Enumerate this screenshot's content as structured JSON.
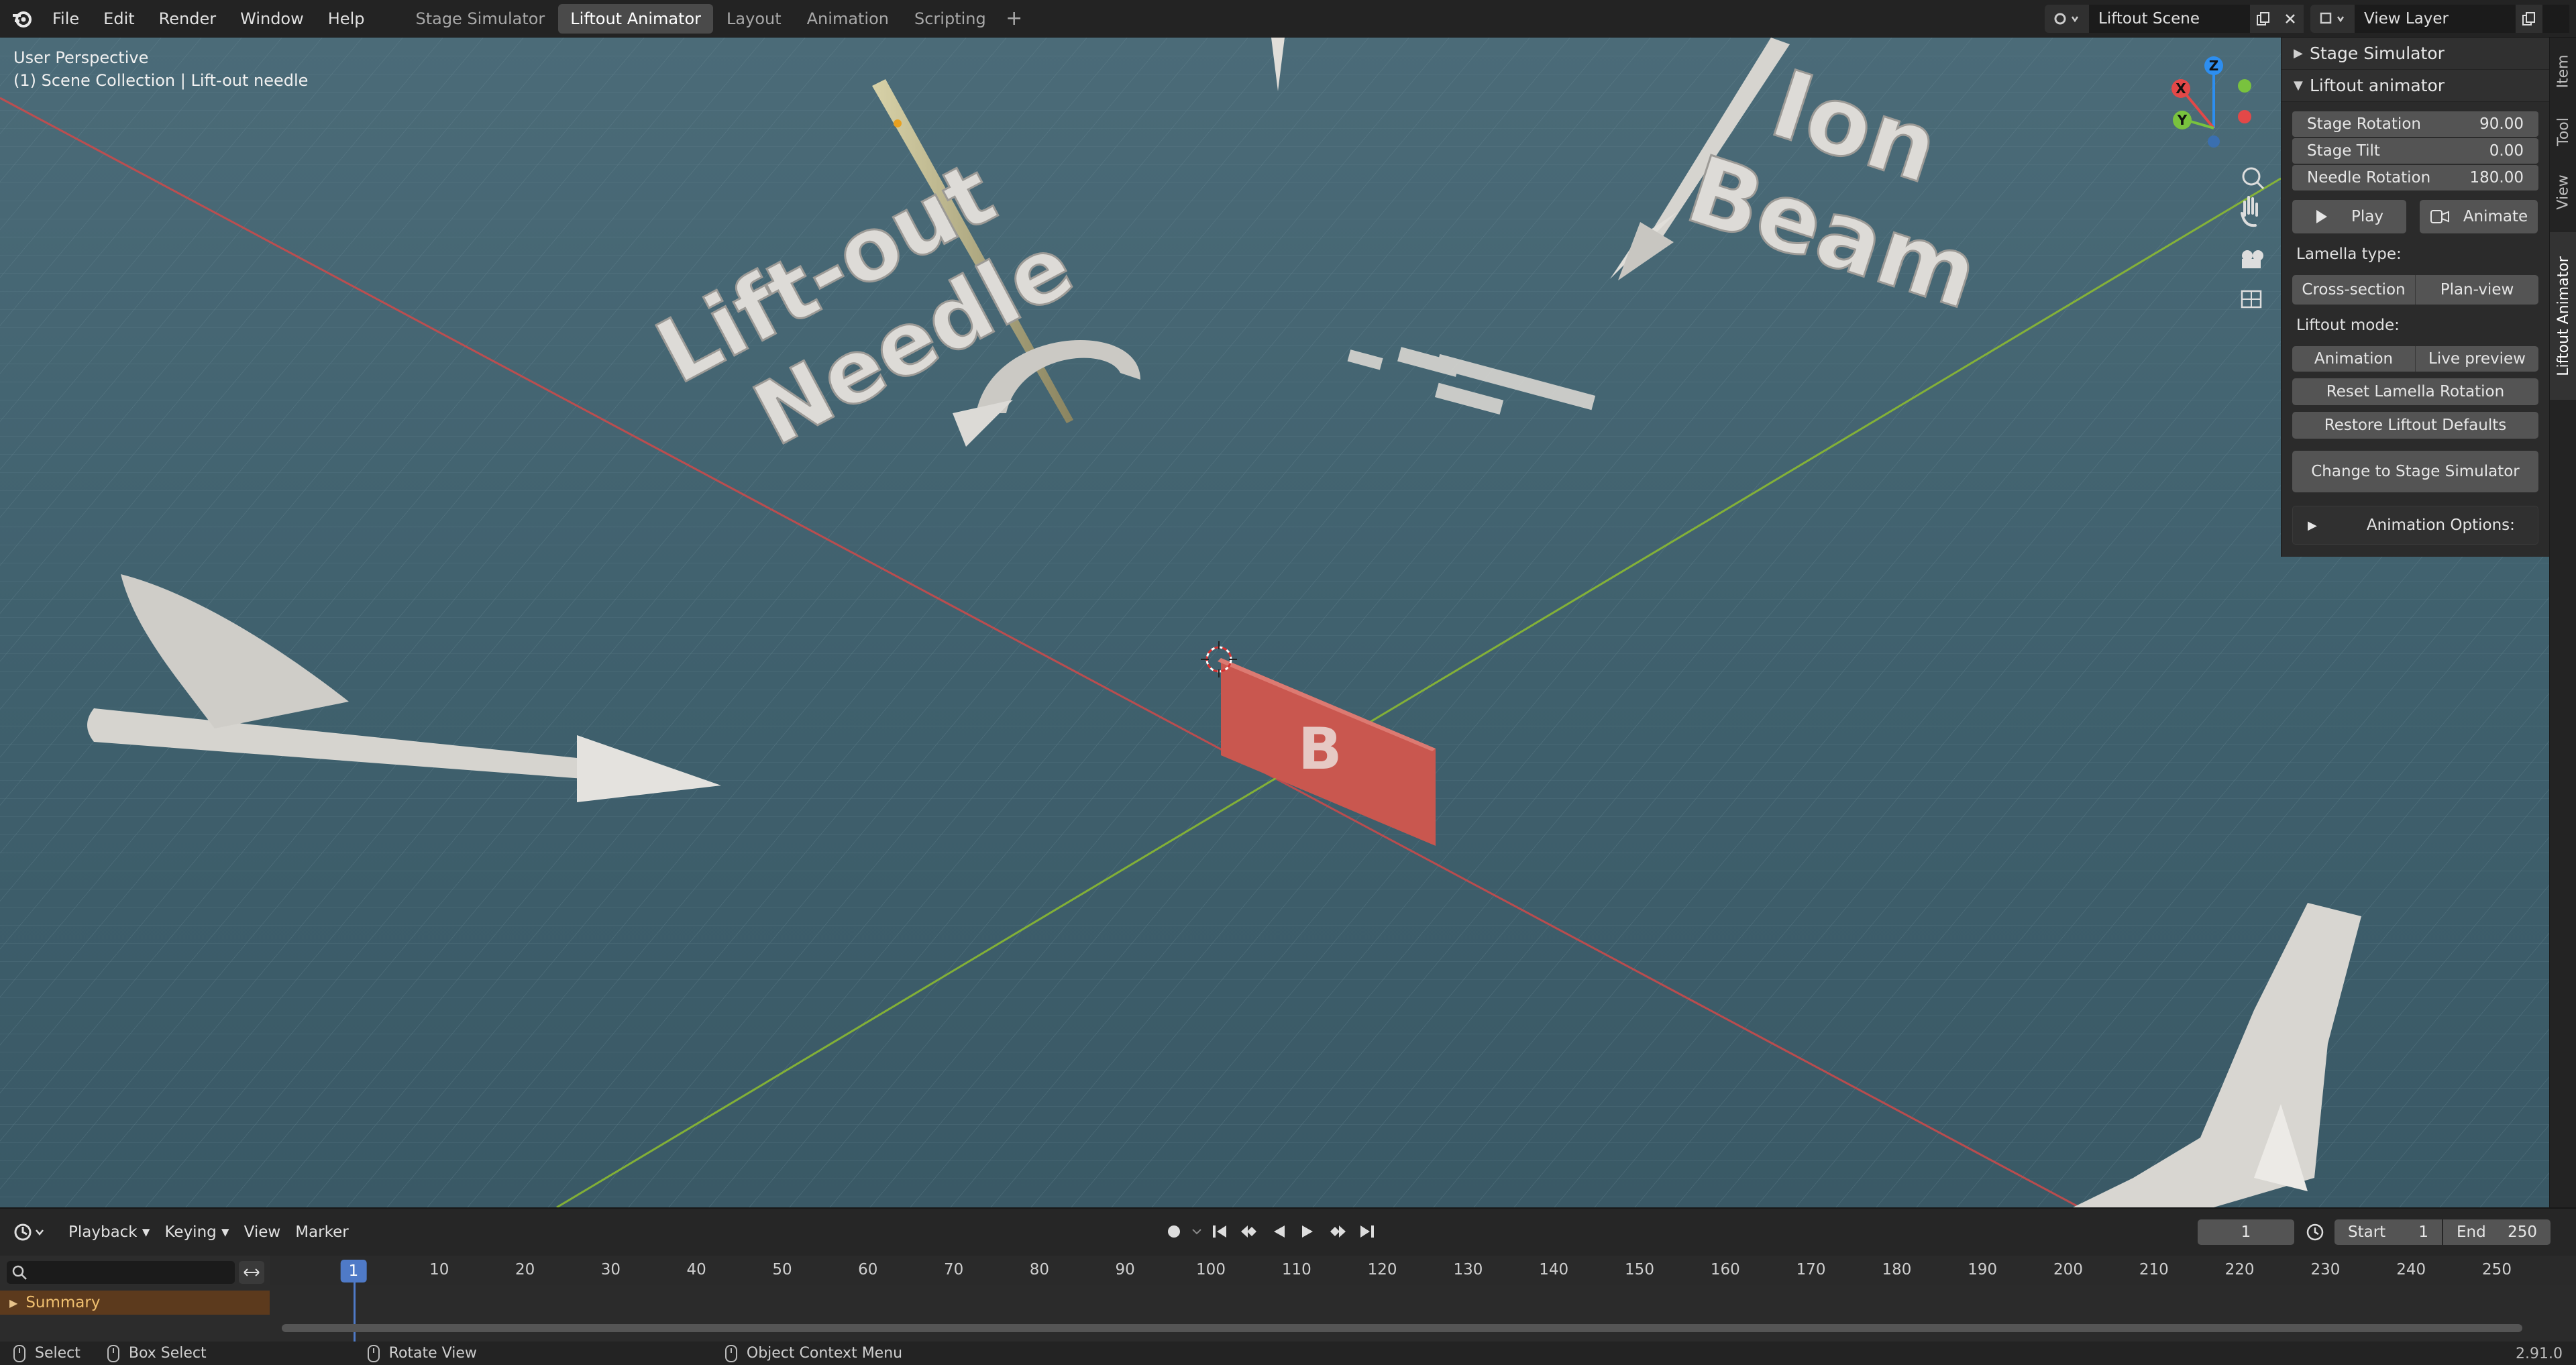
{
  "topbar": {
    "menus": [
      "File",
      "Edit",
      "Render",
      "Window",
      "Help"
    ],
    "workspace_tabs": [
      "Stage Simulator",
      "Liftout Animator",
      "Layout",
      "Animation",
      "Scripting"
    ],
    "active_tab": "Liftout Animator",
    "add_tab_label": "+",
    "scene_name": "Liftout Scene",
    "view_layer": "View Layer"
  },
  "viewport": {
    "perspective": "User Perspective",
    "collection": "(1) Scene Collection | Lift-out needle",
    "scene_labels": {
      "needle": "Lift-out Needle",
      "ion_beam": "Ion Beam",
      "lamella_letter": "B"
    },
    "gizmo": {
      "x": "X",
      "y": "Y",
      "z": "Z"
    },
    "colors": {
      "axis_x": "#d04a4a",
      "axis_y": "#8fbf2f",
      "lamella": "#c9574f"
    }
  },
  "npanel": {
    "sections": {
      "stage_simulator": "Stage Simulator",
      "liftout_animator": "Liftout animator"
    },
    "fields": [
      {
        "label": "Stage Rotation",
        "value": "90.00"
      },
      {
        "label": "Stage Tilt",
        "value": "0.00"
      },
      {
        "label": "Needle Rotation",
        "value": "180.00"
      }
    ],
    "play_label": "Play",
    "animate_label": "Animate",
    "lamella_type_label": "Lamella type:",
    "lamella_types": [
      "Cross-section",
      "Plan-view"
    ],
    "liftout_mode_label": "Liftout mode:",
    "liftout_modes": [
      "Animation",
      "Live preview"
    ],
    "reset_label": "Reset Lamella Rotation",
    "restore_label": "Restore Liftout Defaults",
    "change_label": "Change to Stage Simulator",
    "animation_options_label": "Animation Options:"
  },
  "sidetabs": [
    "Item",
    "Tool",
    "View",
    "Liftout Animator"
  ],
  "timeline": {
    "menus": [
      "Playback",
      "Keying",
      "View",
      "Marker"
    ],
    "current_frame": "1",
    "start_label": "Start",
    "start_value": "1",
    "end_label": "End",
    "end_value": "250",
    "ticks": [
      "10",
      "20",
      "30",
      "40",
      "50",
      "60",
      "70",
      "80",
      "90",
      "100",
      "110",
      "120",
      "130",
      "140",
      "150",
      "160",
      "170",
      "180",
      "190",
      "200",
      "210",
      "220",
      "230",
      "240",
      "250"
    ],
    "summary_label": "Summary"
  },
  "statusbar": {
    "select": "Select",
    "box_select": "Box Select",
    "rotate_view": "Rotate View",
    "context_menu": "Object Context Menu",
    "version": "2.91.0"
  }
}
